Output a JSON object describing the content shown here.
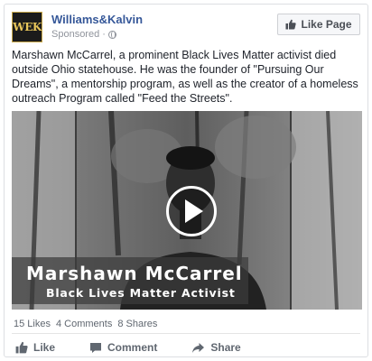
{
  "post": {
    "page_name": "Williams&Kalvin",
    "avatar_text": "WEK",
    "sponsored_label": "Sponsored",
    "sponsored_separator": "·",
    "like_page_label": "Like Page",
    "body_text": "Marshawn McCarrel, a prominent Black Lives Matter activist died outside Ohio statehouse. He was the founder of \"Pursuing Our Dreams\", a mentorship program, as well as the creator of a homeless outreach Program called \"Feed the Streets\"."
  },
  "video": {
    "caption_name": "Marshawn McCarrel",
    "caption_title": "Black Lives Matter Activist"
  },
  "stats": {
    "likes": "15 Likes",
    "comments": "4 Comments",
    "shares": "8 Shares"
  },
  "actions": {
    "like": "Like",
    "comment": "Comment",
    "share": "Share"
  },
  "colors": {
    "link": "#365899",
    "meta": "#90949c",
    "action": "#606770"
  }
}
